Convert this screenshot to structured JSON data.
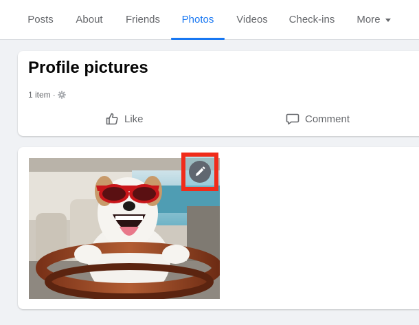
{
  "tabs": [
    {
      "label": "Posts"
    },
    {
      "label": "About"
    },
    {
      "label": "Friends"
    },
    {
      "label": "Photos",
      "active": true
    },
    {
      "label": "Videos"
    },
    {
      "label": "Check-ins"
    },
    {
      "label": "More"
    }
  ],
  "album": {
    "title": "Profile pictures",
    "item_count": "1 item",
    "separator": "·",
    "privacy_icon": "gear-icon"
  },
  "actions": {
    "like_label": "Like",
    "comment_label": "Comment"
  },
  "photo": {
    "edit_icon": "pencil-icon"
  },
  "colors": {
    "accent": "#1877f2",
    "highlight": "#f02c1a",
    "secondary_text": "#65676b",
    "background": "#f0f2f5"
  }
}
